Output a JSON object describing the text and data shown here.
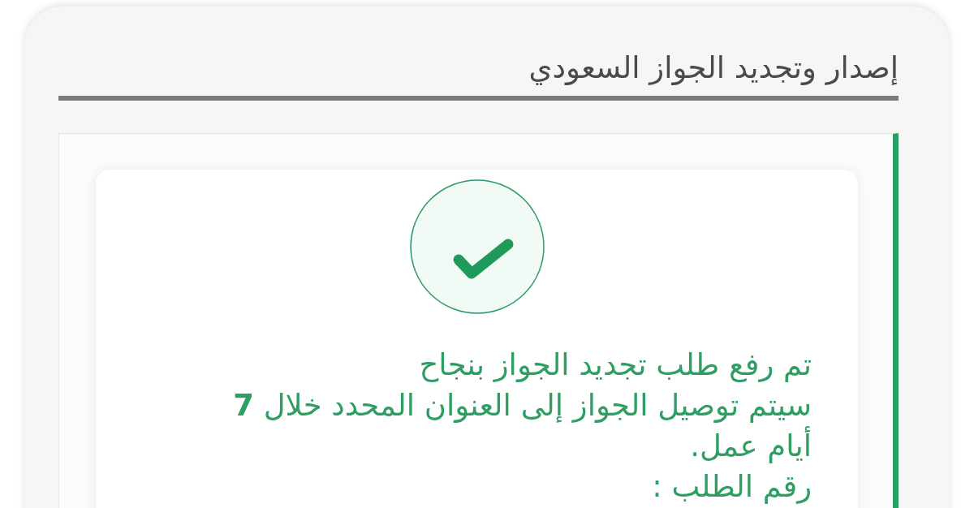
{
  "page": {
    "title": "إصدار وتجديد الجواز السعودي"
  },
  "result": {
    "kind": "success",
    "heading": "تم رفع طلب تجديد الجواز بنجاح",
    "message": "سيتم توصيل الجواز إلى العنوان المحدد خلال **7** أيام عمل.",
    "request_number_label": "رقم الطلب :"
  }
}
